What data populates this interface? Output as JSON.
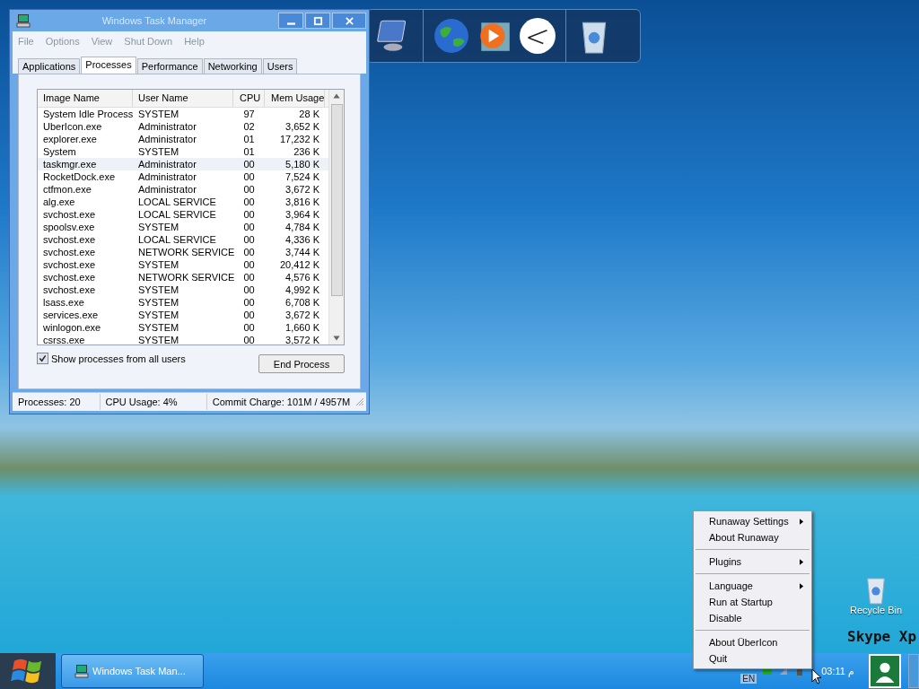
{
  "window": {
    "title": "Windows Task Manager",
    "menu": [
      "File",
      "Options",
      "View",
      "Shut Down",
      "Help"
    ],
    "tabs": [
      {
        "label": "Applications",
        "selected": false
      },
      {
        "label": "Processes",
        "selected": true
      },
      {
        "label": "Performance",
        "selected": false
      },
      {
        "label": "Networking",
        "selected": false
      },
      {
        "label": "Users",
        "selected": false
      }
    ],
    "table": {
      "columns": [
        "Image Name",
        "User Name",
        "CPU",
        "Mem Usage"
      ],
      "rows": [
        {
          "cells": [
            "System Idle Process",
            "SYSTEM",
            "97",
            "28 K"
          ],
          "selected": false
        },
        {
          "cells": [
            "UberIcon.exe",
            "Administrator",
            "02",
            "3,652 K"
          ],
          "selected": false
        },
        {
          "cells": [
            "explorer.exe",
            "Administrator",
            "01",
            "17,232 K"
          ],
          "selected": false
        },
        {
          "cells": [
            "System",
            "SYSTEM",
            "01",
            "236 K"
          ],
          "selected": false
        },
        {
          "cells": [
            "taskmgr.exe",
            "Administrator",
            "00",
            "5,180 K"
          ],
          "selected": true
        },
        {
          "cells": [
            "RocketDock.exe",
            "Administrator",
            "00",
            "7,524 K"
          ],
          "selected": false
        },
        {
          "cells": [
            "ctfmon.exe",
            "Administrator",
            "00",
            "3,672 K"
          ],
          "selected": false
        },
        {
          "cells": [
            "alg.exe",
            "LOCAL SERVICE",
            "00",
            "3,816 K"
          ],
          "selected": false
        },
        {
          "cells": [
            "svchost.exe",
            "LOCAL SERVICE",
            "00",
            "3,964 K"
          ],
          "selected": false
        },
        {
          "cells": [
            "spoolsv.exe",
            "SYSTEM",
            "00",
            "4,784 K"
          ],
          "selected": false
        },
        {
          "cells": [
            "svchost.exe",
            "LOCAL SERVICE",
            "00",
            "4,336 K"
          ],
          "selected": false
        },
        {
          "cells": [
            "svchost.exe",
            "NETWORK SERVICE",
            "00",
            "3,744 K"
          ],
          "selected": false
        },
        {
          "cells": [
            "svchost.exe",
            "SYSTEM",
            "00",
            "20,412 K"
          ],
          "selected": false
        },
        {
          "cells": [
            "svchost.exe",
            "NETWORK SERVICE",
            "00",
            "4,576 K"
          ],
          "selected": false
        },
        {
          "cells": [
            "svchost.exe",
            "SYSTEM",
            "00",
            "4,992 K"
          ],
          "selected": false
        },
        {
          "cells": [
            "lsass.exe",
            "SYSTEM",
            "00",
            "6,708 K"
          ],
          "selected": false
        },
        {
          "cells": [
            "services.exe",
            "SYSTEM",
            "00",
            "3,672 K"
          ],
          "selected": false
        },
        {
          "cells": [
            "winlogon.exe",
            "SYSTEM",
            "00",
            "1,660 K"
          ],
          "selected": false
        },
        {
          "cells": [
            "csrss.exe",
            "SYSTEM",
            "00",
            "3,572 K"
          ],
          "selected": false
        }
      ]
    },
    "show_all_users": {
      "label": "Show processes from all users",
      "checked": true
    },
    "end_button": "End Process",
    "status_bar": [
      "Processes: 20",
      "CPU Usage: 4%",
      "Commit Charge: 101M / 4957M"
    ]
  },
  "context_menu": [
    {
      "kind": "item",
      "label": "Runaway Settings",
      "submenu": true
    },
    {
      "kind": "item",
      "label": "About Runaway",
      "submenu": false
    },
    {
      "kind": "separator"
    },
    {
      "kind": "item",
      "label": "Plugins",
      "submenu": true
    },
    {
      "kind": "separator"
    },
    {
      "kind": "item",
      "label": "Language",
      "submenu": true
    },
    {
      "kind": "item",
      "label": "Run at Startup",
      "submenu": false
    },
    {
      "kind": "item",
      "label": "Disable",
      "submenu": false
    },
    {
      "kind": "separator"
    },
    {
      "kind": "item",
      "label": "About ÜberIcon",
      "submenu": false
    },
    {
      "kind": "item",
      "label": "Quit",
      "submenu": false
    }
  ],
  "desktop": {
    "recycle_bin": "Recycle Bin",
    "logo_text": "Skype Xp"
  },
  "taskbar": {
    "task_button": "Windows Task Man...",
    "language": "EN",
    "clock": "03:11 م"
  }
}
